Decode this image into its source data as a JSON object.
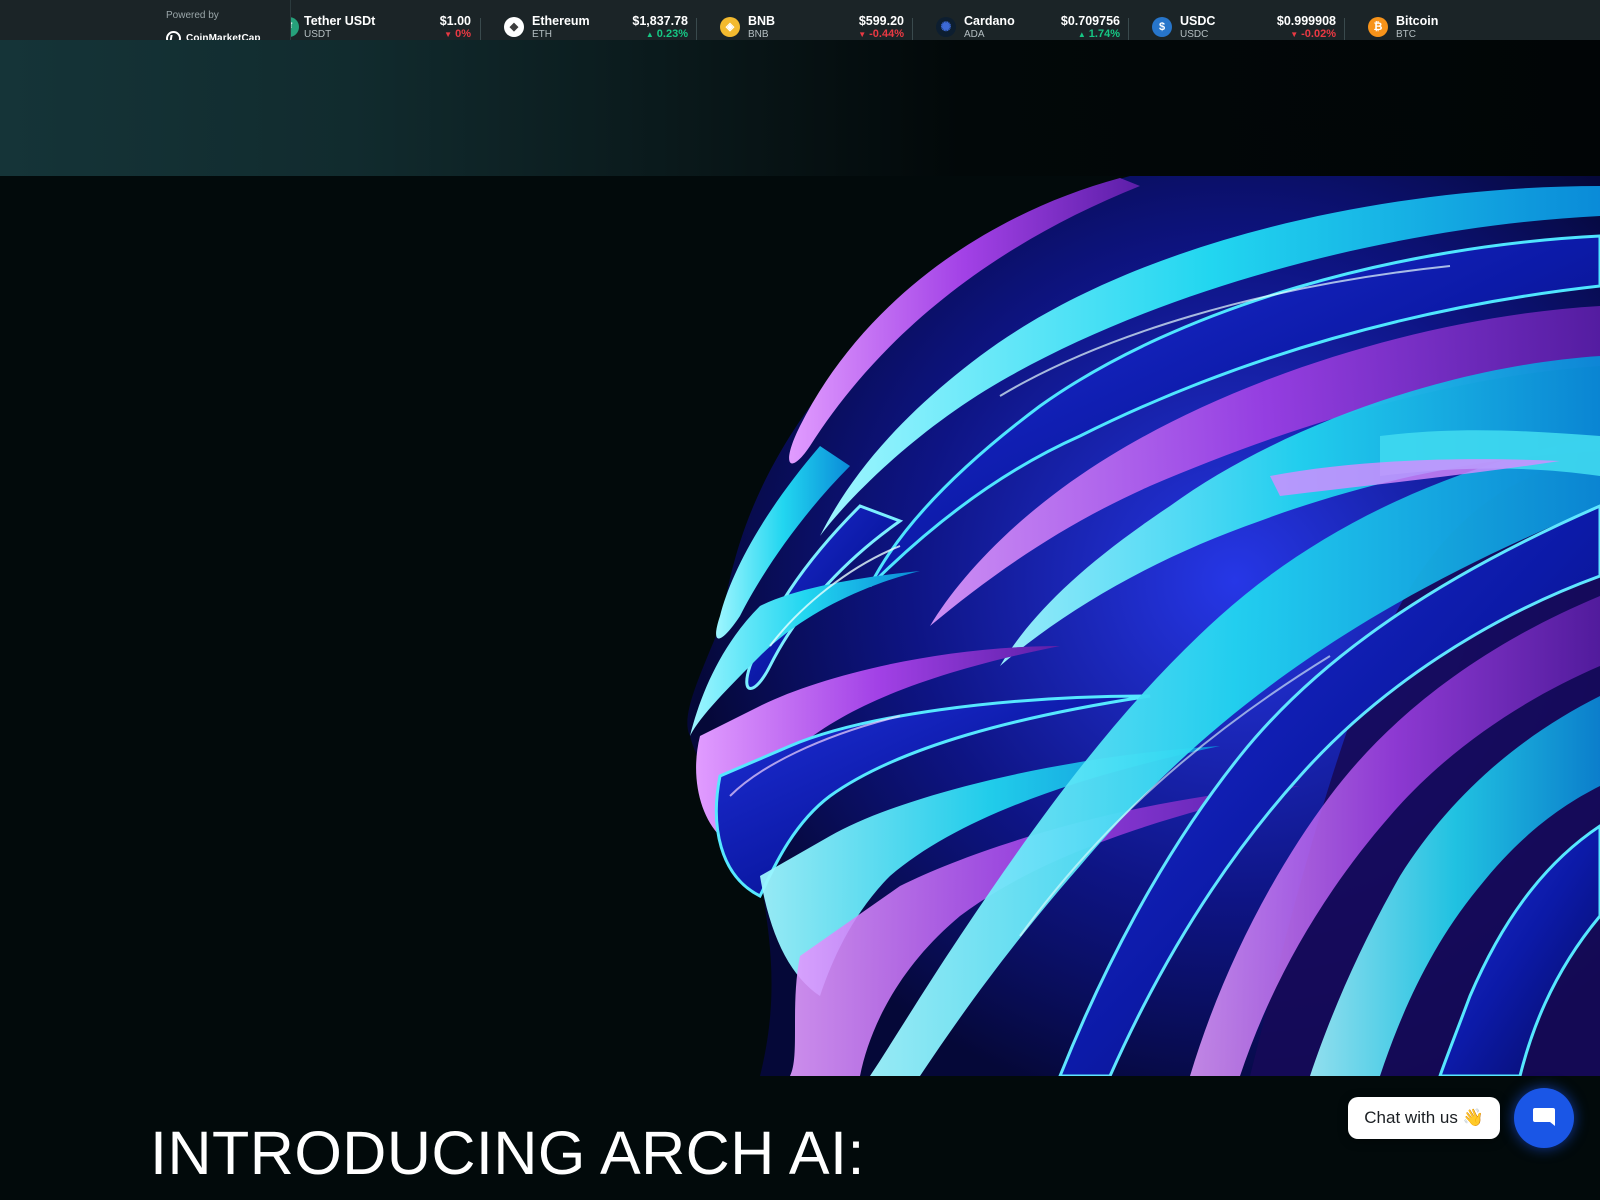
{
  "ticker": {
    "powered_by": "Powered by",
    "provider": "CoinMarketCap",
    "coins": [
      {
        "name": "Tether USDt",
        "symbol": "USDT",
        "price": "$1.00",
        "change": "0%",
        "direction": "down",
        "icon": "tether-icon",
        "color": "#26a17b",
        "glyph": "₮"
      },
      {
        "name": "Ethereum",
        "symbol": "ETH",
        "price": "$1,837.78",
        "change": "0.23%",
        "direction": "up",
        "icon": "ethereum-icon",
        "color": "#ffffff",
        "glyph": "◆"
      },
      {
        "name": "BNB",
        "symbol": "BNB",
        "price": "$599.20",
        "change": "-0.44%",
        "direction": "down",
        "icon": "bnb-icon",
        "color": "#f3ba2f",
        "glyph": "◈"
      },
      {
        "name": "Cardano",
        "symbol": "ADA",
        "price": "$0.709756",
        "change": "1.74%",
        "direction": "up",
        "icon": "cardano-icon",
        "color": "#0d1e30",
        "glyph": "✺"
      },
      {
        "name": "USDC",
        "symbol": "USDC",
        "price": "$0.999908",
        "change": "-0.02%",
        "direction": "down",
        "icon": "usdc-icon",
        "color": "#2775ca",
        "glyph": "$"
      },
      {
        "name": "Bitcoin",
        "symbol": "BTC",
        "price": "",
        "change": "",
        "direction": "",
        "icon": "bitcoin-icon",
        "color": "#f7931a",
        "glyph": "₿"
      }
    ]
  },
  "hero": {
    "headline": "INTRODUCING ARCH AI:"
  },
  "chat": {
    "label": "Chat with us 👋"
  },
  "colors": {
    "background": "#020a0b",
    "ticker_bg": "#1b2427",
    "up": "#16c784",
    "down": "#ea3943",
    "chat_button": "#1a56e6"
  }
}
